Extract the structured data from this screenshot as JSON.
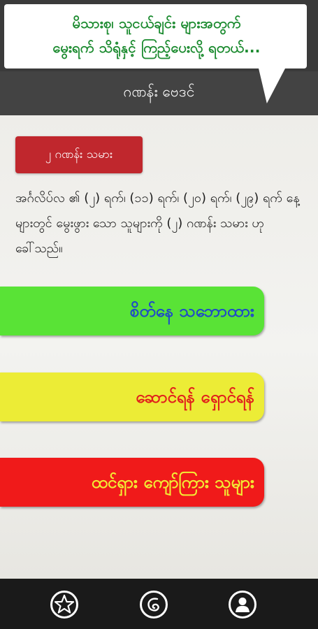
{
  "header": {
    "bubble_line1": "မိသားစု၊ သူငယ်ချင်း များအတွက်",
    "bubble_line2": "မွေးရက် သိရုံနှင့် ကြည့်ပေးလို့ ရတယ်...",
    "title": "ဂဏန်း ဗေဒင်"
  },
  "main": {
    "category_label": "၂ ဂဏန်း သမား",
    "description": "အင်္ဂလိပ်လ ၏ (၂) ရက်၊ (၁၁) ရက်၊ (၂၀) ရက်၊ (၂၉) ရက် နေ့များတွင် မွေးဖွား သော သူများကို (၂) ဂဏန်း သမား ဟုခေါ်သည်။",
    "buttons": [
      {
        "label": "စိတ်နေ သဘောထား",
        "color": "#59e336",
        "text_color": "#1f49c9"
      },
      {
        "label": "ဆောင်ရန် ရှောင်ရန်",
        "color": "#ecec36",
        "text_color": "#e1201c"
      },
      {
        "label": "ထင်ရှား ကျော်ကြား သူများ",
        "color": "#f01a1a",
        "text_color": "#f2ed34"
      }
    ]
  },
  "bottom_nav": {
    "icons": [
      "star-icon",
      "myanmar-letter-icon",
      "person-icon"
    ]
  }
}
